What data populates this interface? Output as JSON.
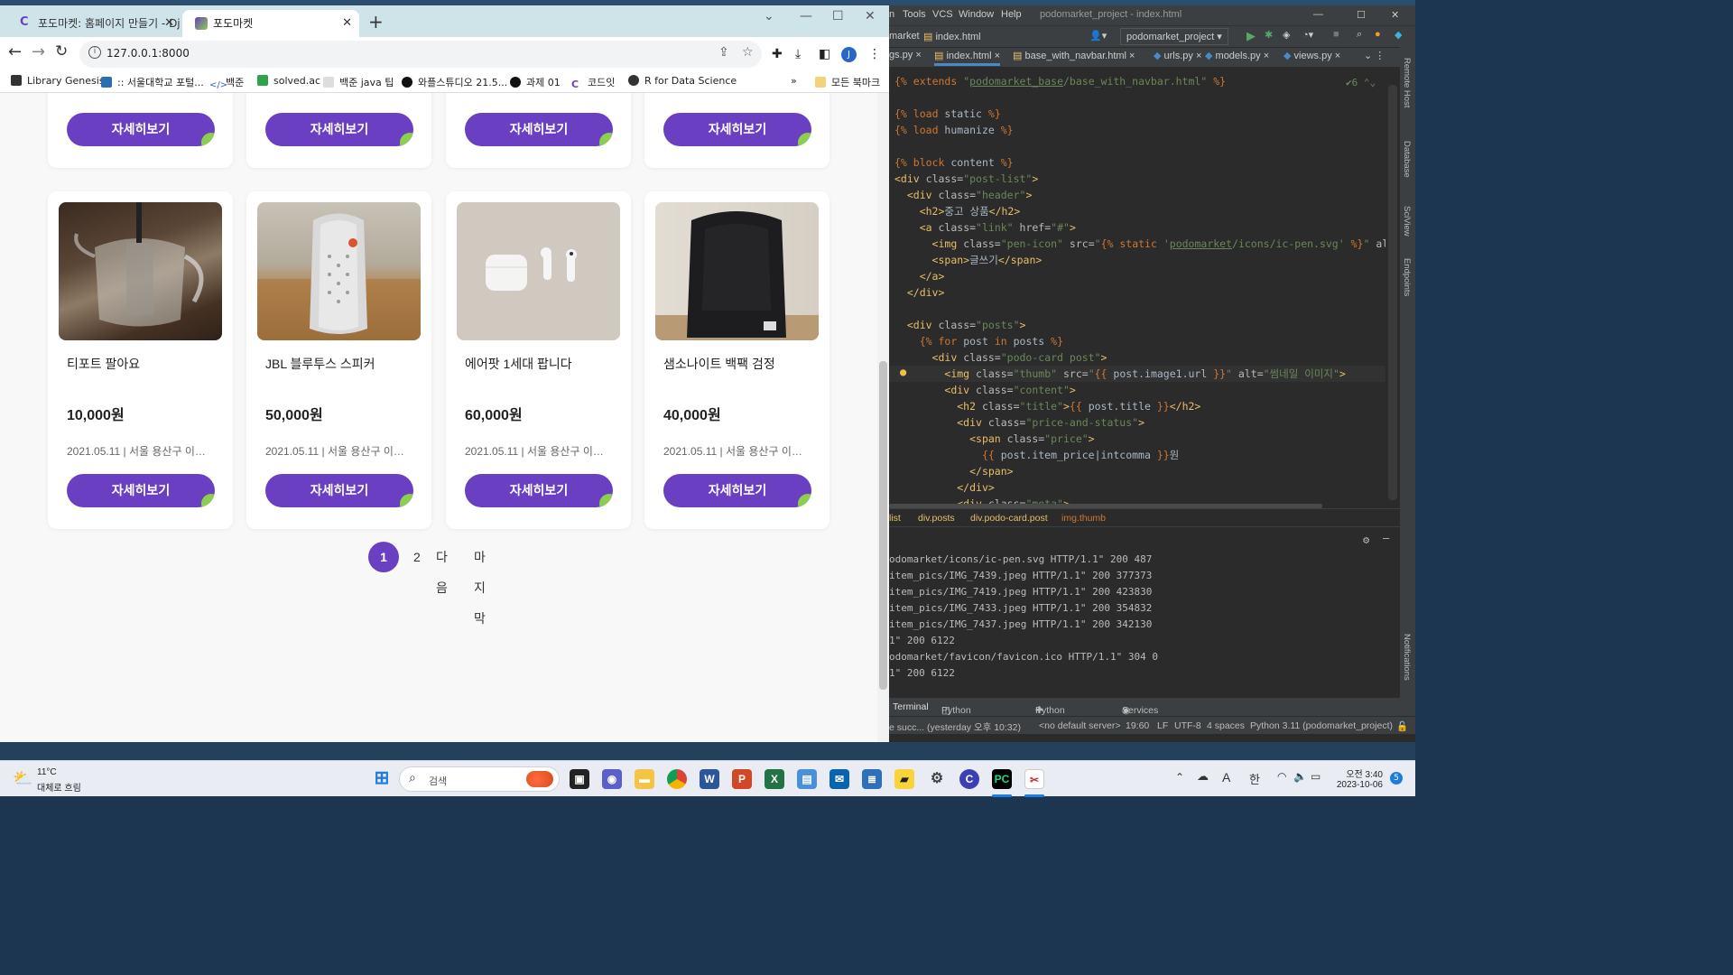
{
  "browser": {
    "tabs": [
      {
        "title": "포도마켓: 홈페이지 만들기 - Dj"
      },
      {
        "title": "포도마켓"
      }
    ],
    "url": "127.0.0.1:8000",
    "avatar_letter": "J",
    "bookmarks": [
      "Library Genesis",
      ":: 서울대학교 포털...",
      "백준",
      "solved.ac",
      "백준 java 팁",
      "와플스튜디오 21.5...",
      "과제 01",
      "코드잇",
      "R for Data Science"
    ],
    "bookmarks_more": "»",
    "all_bookmarks": "모든 북마크"
  },
  "page": {
    "detail_button_label": "자세히보기",
    "top_row_count": 4,
    "posts": [
      {
        "title": "티포트 팔아요",
        "price": "10,000원",
        "meta": "2021.05.11 | 서울 용산구 이…",
        "image": "teapot-photo"
      },
      {
        "title": "JBL 블루투스 스피커",
        "price": "50,000원",
        "meta": "2021.05.11 | 서울 용산구 이…",
        "image": "speaker-photo"
      },
      {
        "title": "에어팟 1세대 팝니다",
        "price": "60,000원",
        "meta": "2021.05.11 | 서울 용산구 이…",
        "image": "airpods-photo"
      },
      {
        "title": "샘소나이트 백팩 검정",
        "price": "40,000원",
        "meta": "2021.05.11 | 서울 용산구 이…",
        "image": "backpack-photo"
      }
    ],
    "pagination": {
      "current": "1",
      "next_page": "2",
      "next_label": "다음",
      "last_label": "마지막"
    },
    "accent_color": "#6a3fc2",
    "leaf_color": "#8ccf4e"
  },
  "ide": {
    "menu": [
      "n",
      "Tools",
      "VCS",
      "Window",
      "Help"
    ],
    "window_title": "podomarket_project - index.html",
    "toolbar_crumbs": [
      "market",
      "index.html"
    ],
    "run_config": "podomarket_project",
    "tabs": [
      "gs.py",
      "index.html",
      "base_with_navbar.html",
      "urls.py",
      "models.py",
      "views.py"
    ],
    "problems_count": "6",
    "code_lines": [
      "{% extends \"podomarket_base/base_with_navbar.html\" %}",
      "",
      "{% load static %}",
      "{% load humanize %}",
      "",
      "{% block content %}",
      "<div class=\"post-list\">",
      "  <div class=\"header\">",
      "    <h2>중고 상품</h2>",
      "    <a class=\"link\" href=\"#\">",
      "      <img class=\"pen-icon\" src=\"{% static 'podomarket/icons/ic-pen.svg' %}\" alt=\"pen",
      "      <span>글쓰기</span>",
      "    </a>",
      "  </div>",
      "",
      "  <div class=\"posts\">",
      "    {% for post in posts %}",
      "      <div class=\"podo-card post\">",
      "        <img class=\"thumb\" src=\"{{ post.image1.url }}\" alt=\"썸네일 이미지\">",
      "        <div class=\"content\">",
      "          <h2 class=\"title\">{{ post.title }}</h2>",
      "          <div class=\"price-and-status\">",
      "            <span class=\"price\">",
      "              {{ post.item_price|intcomma }}원",
      "            </span>",
      "          </div>",
      "          <div class=\"meta\">"
    ],
    "breadcrumb": [
      "list",
      "div.posts",
      "div.podo-card.post",
      "img.thumb"
    ],
    "terminal_lines": [
      "odomarket/icons/ic-pen.svg HTTP/1.1\" 200 487",
      "item_pics/IMG_7439.jpeg HTTP/1.1\" 200 377373",
      "item_pics/IMG_7419.jpeg HTTP/1.1\" 200 423830",
      "item_pics/IMG_7433.jpeg HTTP/1.1\" 200 354832",
      "item_pics/IMG_7437.jpeg HTTP/1.1\" 200 342130",
      "1\" 200 6122",
      "odomarket/favicon/favicon.ico HTTP/1.1\" 304 0",
      "1\" 200 6122"
    ],
    "tool_windows": [
      "Terminal",
      "Python Packages",
      "Python Console",
      "Services"
    ],
    "status": [
      "e succ... (yesterday 오후 10:32)",
      "<no default server>",
      "19:60",
      "LF",
      "UTF-8",
      "4 spaces",
      "Python 3.11 (podomarket_project)"
    ],
    "side_panels": [
      "Remote Host",
      "Database",
      "SciView",
      "Endpoints",
      "Notifications"
    ]
  },
  "taskbar": {
    "weather_temp": "11°C",
    "weather_desc": "대체로 흐림",
    "search_placeholder": "검색",
    "ime_lang": "A",
    "ime_korean": "한",
    "time": "오전 3:40",
    "date": "2023-10-06",
    "notif_count": "5"
  }
}
